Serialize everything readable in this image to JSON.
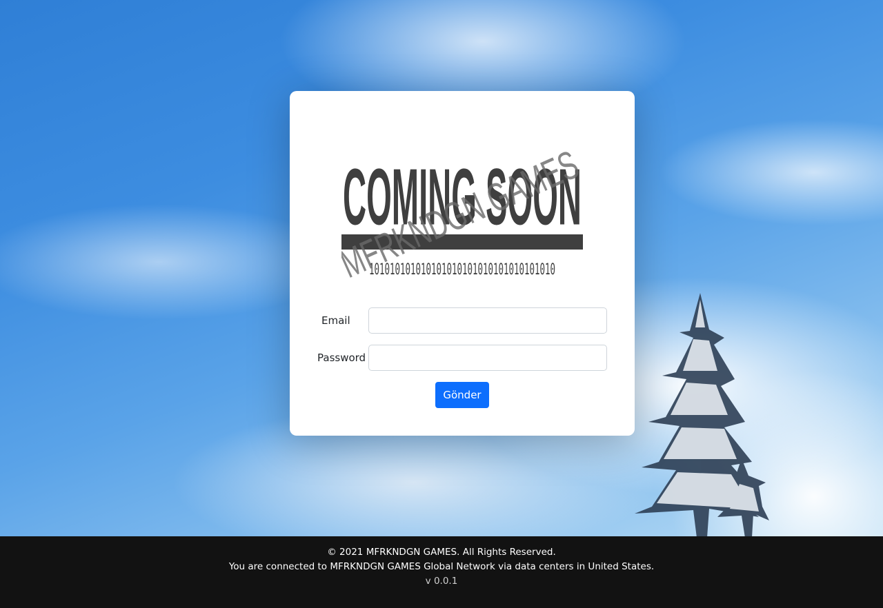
{
  "login_card": {
    "logo": {
      "headline": "COMING SOON",
      "overlay_text": "MFRKNDGN GAMES",
      "binary_text": "101010101010101010101010101010101010"
    },
    "form": {
      "email_label": "Email",
      "email_value": "",
      "password_label": "Password",
      "password_value": "",
      "submit_label": "Gönder"
    }
  },
  "footer": {
    "copyright": "© 2021 MFRKNDGN GAMES. All Rights Reserved.",
    "network_notice": "You are connected to MFRKNDGN GAMES Global Network via data centers in United States.",
    "version": "v 0.0.1"
  },
  "colors": {
    "primary_button": "#0d6efd",
    "footer_background": "#121212",
    "logo_ink": "#3f3f3f"
  }
}
